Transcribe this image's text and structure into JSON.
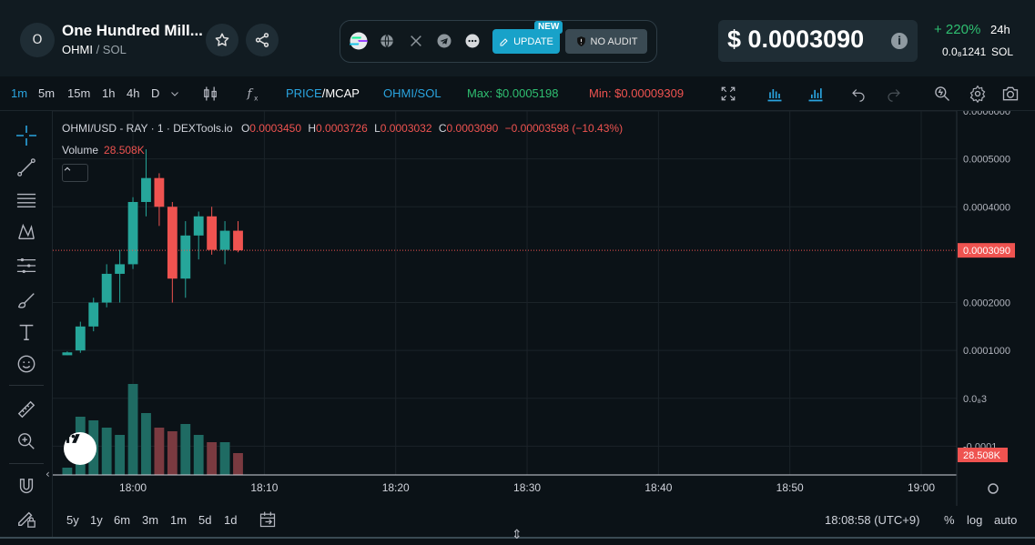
{
  "header": {
    "logo_letter": "O",
    "token_name": "One Hundred Mill...",
    "token_symbol": "OHMI",
    "pair_sep": " / ",
    "quote_symbol": "SOL",
    "update_label": "UPDATE",
    "new_badge": "NEW",
    "no_audit_label": "NO AUDIT",
    "price": "$ 0.0003090",
    "price_info": "i",
    "change": "+ 220%",
    "change_period": "24h",
    "sol_price": "0.0₈1241",
    "sol_unit": "SOL"
  },
  "toolbar": {
    "intervals": [
      "1m",
      "5m",
      "15m",
      "1h",
      "4h",
      "D"
    ],
    "active_interval": "1m",
    "price_label": "PRICE",
    "mcap_label": "/MCAP",
    "pair_label": "OHMI/SOL",
    "max_label": "Max: $0.0005198",
    "min_label": "Min: $0.00009309"
  },
  "legend": {
    "symbol": "OHMI/USD - RAY · 1 · DEXTools.io",
    "o_key": "O",
    "o_val": "0.0003450",
    "h_key": "H",
    "h_val": "0.0003726",
    "l_key": "L",
    "l_val": "0.0003032",
    "c_key": "C",
    "c_val": "0.0003090",
    "change": "−0.00003598 (−10.43%)",
    "volume_label": "Volume",
    "volume_value": "28.508K"
  },
  "colors": {
    "up": "#26a69a",
    "down": "#ef5350",
    "vol_up": "#1f6b63",
    "vol_down": "#7a3a40",
    "grid": "#1b2329",
    "bg": "#0b1217"
  },
  "chart_data": {
    "type": "candlestick",
    "y_ticks": [
      "0.0006000",
      "0.0005000",
      "0.0004000",
      "0.0002000",
      "0.0001000",
      "0.0₈3",
      "-0.0001"
    ],
    "y_tick_values": [
      0.0006,
      0.0005,
      0.0004,
      0.0002,
      0.0001,
      0.0,
      -0.0001
    ],
    "last_price_label": "0.0003090",
    "last_price": 0.000309,
    "volume_label_right": "28.508K",
    "x_ticks": [
      "18:00",
      "18:10",
      "18:20",
      "18:30",
      "18:40",
      "18:50",
      "19:00"
    ],
    "x_tick_minutes": [
      0,
      10,
      20,
      30,
      40,
      50,
      60
    ],
    "y_range": [
      -0.00016,
      0.0006
    ],
    "x_range_minutes": [
      -6.1,
      62.7
    ],
    "candles": [
      {
        "t": -5,
        "o": 9e-05,
        "h": 9.8e-05,
        "l": 9e-05,
        "c": 9.6e-05
      },
      {
        "t": -4,
        "o": 0.0001,
        "h": 0.00016,
        "l": 9.5e-05,
        "c": 0.00015
      },
      {
        "t": -3,
        "o": 0.00015,
        "h": 0.00021,
        "l": 0.00014,
        "c": 0.0002
      },
      {
        "t": -2,
        "o": 0.0002,
        "h": 0.00028,
        "l": 0.00019,
        "c": 0.00026
      },
      {
        "t": -1,
        "o": 0.00026,
        "h": 0.00031,
        "l": 0.0002,
        "c": 0.00028
      },
      {
        "t": 0,
        "o": 0.00028,
        "h": 0.00042,
        "l": 0.00027,
        "c": 0.00041
      },
      {
        "t": 1,
        "o": 0.00041,
        "h": 0.00052,
        "l": 0.00038,
        "c": 0.00046
      },
      {
        "t": 2,
        "o": 0.00046,
        "h": 0.00047,
        "l": 0.00036,
        "c": 0.0004
      },
      {
        "t": 3,
        "o": 0.0004,
        "h": 0.00041,
        "l": 0.0002,
        "c": 0.00025
      },
      {
        "t": 4,
        "o": 0.00025,
        "h": 0.00037,
        "l": 0.00021,
        "c": 0.00034
      },
      {
        "t": 5,
        "o": 0.00034,
        "h": 0.00039,
        "l": 0.00029,
        "c": 0.00038
      },
      {
        "t": 6,
        "o": 0.00038,
        "h": 0.0004,
        "l": 0.0003,
        "c": 0.00031
      },
      {
        "t": 7,
        "o": 0.00031,
        "h": 0.00037,
        "l": 0.00028,
        "c": 0.00035
      },
      {
        "t": 8,
        "o": 0.00035,
        "h": 0.00037,
        "l": 0.000305,
        "c": 0.000309
      }
    ],
    "volumes": [
      {
        "t": -5,
        "v": 2,
        "up": true
      },
      {
        "t": -4,
        "v": 16,
        "up": true
      },
      {
        "t": -3,
        "v": 15,
        "up": true
      },
      {
        "t": -2,
        "v": 13,
        "up": true
      },
      {
        "t": -1,
        "v": 11,
        "up": true
      },
      {
        "t": 0,
        "v": 25,
        "up": true
      },
      {
        "t": 1,
        "v": 17,
        "up": true
      },
      {
        "t": 2,
        "v": 13,
        "up": false
      },
      {
        "t": 3,
        "v": 12,
        "up": false
      },
      {
        "t": 4,
        "v": 14,
        "up": true
      },
      {
        "t": 5,
        "v": 11,
        "up": true
      },
      {
        "t": 6,
        "v": 9,
        "up": false
      },
      {
        "t": 7,
        "v": 9,
        "up": true
      },
      {
        "t": 8,
        "v": 6,
        "up": false
      }
    ],
    "volume_max": 25
  },
  "bottom": {
    "ranges": [
      "5y",
      "1y",
      "6m",
      "3m",
      "1m",
      "5d",
      "1d"
    ],
    "time": "18:08:58 (UTC+9)",
    "pct": "%",
    "log": "log",
    "auto": "auto"
  },
  "misc": {
    "tv_logo": "17",
    "collapse": "˄"
  }
}
